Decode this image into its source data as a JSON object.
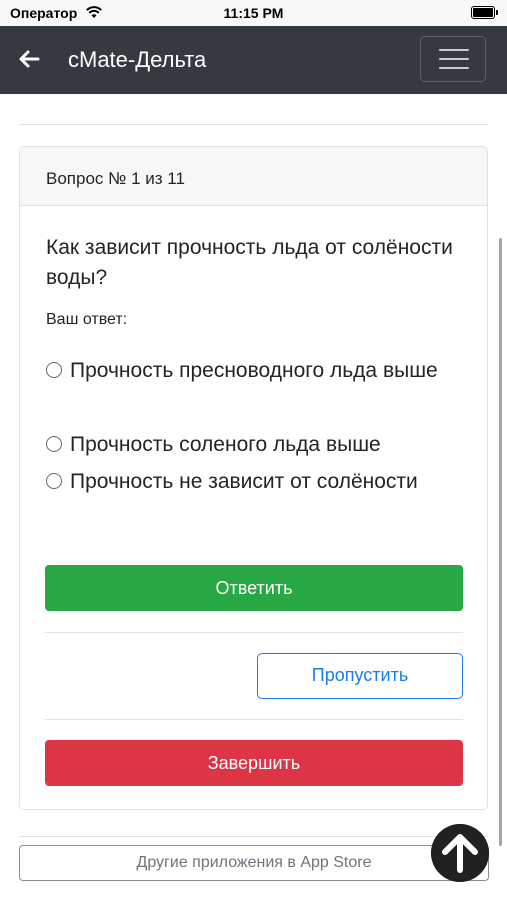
{
  "status_bar": {
    "carrier": "Оператор",
    "time": "11:15 PM"
  },
  "navbar": {
    "title": "сMate-Дельта"
  },
  "card": {
    "header": "Вопрос № 1 из 11",
    "question": "Как зависит прочность льда от солёности воды?",
    "answer_label": "Ваш ответ:",
    "options": [
      "Прочность пресноводного льда выше",
      "Прочность соленого льда выше",
      "Прочность не зависит от солёности"
    ],
    "answer_button": "Ответить",
    "skip_button": "Пропустить",
    "finish_button": "Завершить"
  },
  "footer": {
    "appstore_button": "Другие приложения в App Store"
  },
  "colors": {
    "navbar": "#343a40",
    "success": "#28a745",
    "primary": "#1a7bf2",
    "danger": "#dc3545"
  },
  "icons": {
    "back": "arrow-left-icon",
    "menu": "hamburger-menu-icon",
    "scroll_top": "arrow-up-circle-icon"
  }
}
